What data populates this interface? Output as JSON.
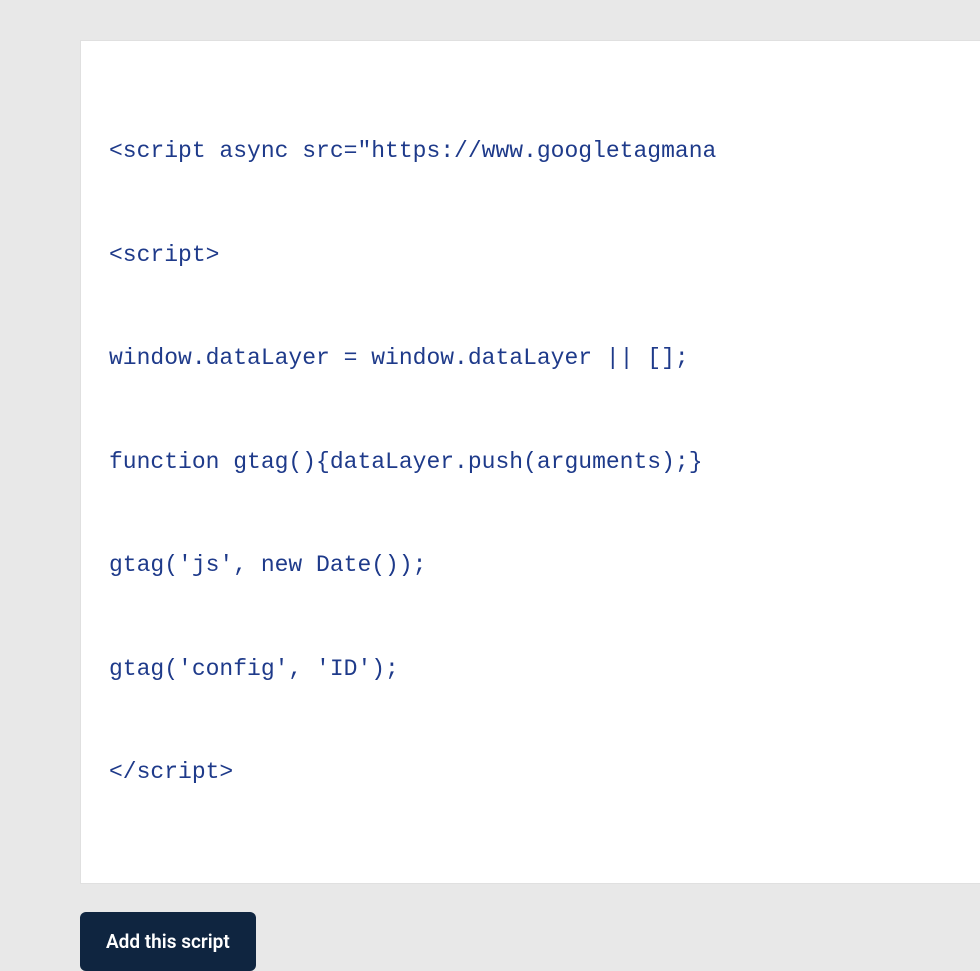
{
  "code": {
    "lines": [
      "<script async src=\"https://www.googletagmana",
      "<script>",
      "window.dataLayer = window.dataLayer || [];",
      "function gtag(){dataLayer.push(arguments);}",
      "gtag('js', new Date());",
      "gtag('config', 'ID');",
      "</script>"
    ]
  },
  "actions": {
    "add_label": "Add this script"
  }
}
